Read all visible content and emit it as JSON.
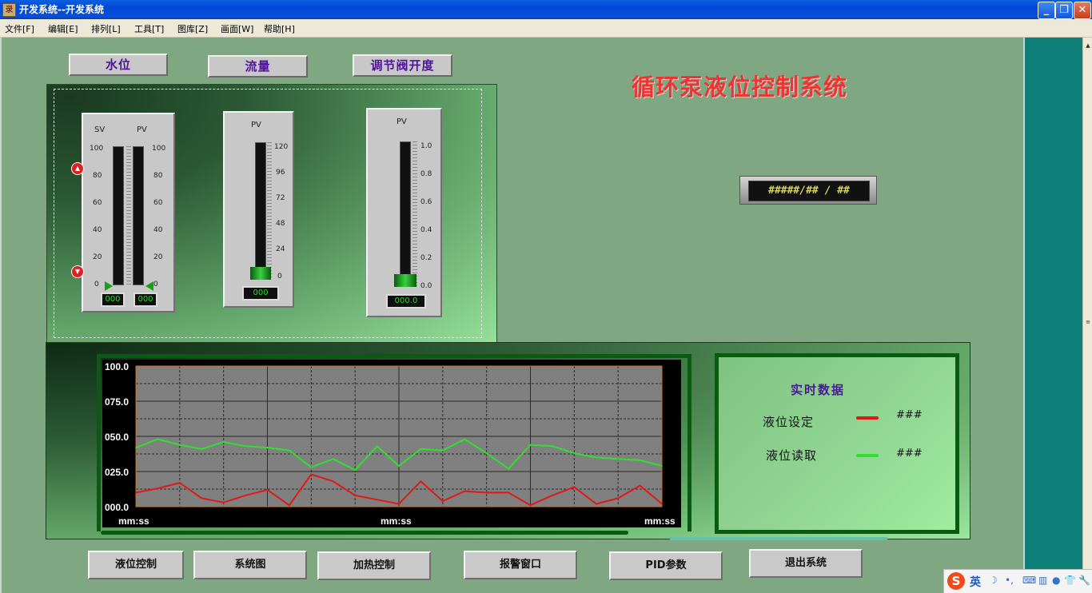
{
  "window": {
    "title": "开发系统--开发系统",
    "icon_glyph": "录",
    "minimize_glyph": "_",
    "maximize_glyph": "❐",
    "close_glyph": "✕"
  },
  "menu": [
    "文件[F]",
    "编辑[E]",
    "排列[L]",
    "工具[T]",
    "图库[Z]",
    "画面[W]",
    "帮助[H]"
  ],
  "tabs": {
    "water_level": "水位",
    "flow": "流量",
    "valve_opening": "调节阀开度"
  },
  "system_title": "循环泵液位控制系统",
  "lcd_display": "#####/## / ##",
  "gauges": {
    "level": {
      "sv_label": "SV",
      "pv_label": "PV",
      "ticks": [
        "100",
        "80",
        "60",
        "40",
        "20",
        "0"
      ],
      "sv_readout": "000",
      "pv_readout": "000",
      "sv_fill_fraction": 0,
      "pv_fill_fraction": 0
    },
    "flow": {
      "label": "PV",
      "ticks": [
        "120",
        "96",
        "72",
        "48",
        "24",
        "0"
      ],
      "readout": "000",
      "fill_fraction": 0.08
    },
    "valve": {
      "label": "PV",
      "ticks": [
        "1.0",
        "0.8",
        "0.6",
        "0.4",
        "0.2",
        "0.0"
      ],
      "readout": "000.0",
      "fill_fraction": 0.08
    }
  },
  "chart_data": {
    "type": "line",
    "ylim": [
      0,
      100
    ],
    "y_ticks": [
      "100.0",
      "075.0",
      "050.0",
      "025.0",
      "000.0"
    ],
    "x_labels": [
      "mm:ss",
      "mm:ss",
      "mm:ss"
    ],
    "x": [
      0,
      1,
      2,
      3,
      4,
      5,
      6,
      7,
      8,
      9,
      10,
      11,
      12,
      13,
      14,
      15,
      16,
      17,
      18,
      19,
      20,
      21,
      22,
      23,
      24
    ],
    "series": [
      {
        "color": "#30e030",
        "values": [
          42,
          48,
          44,
          41,
          46,
          43,
          42,
          40,
          28,
          34,
          26,
          43,
          29,
          41,
          40,
          48,
          38,
          27,
          44,
          43,
          38,
          35,
          34,
          33,
          29
        ]
      },
      {
        "color": "#e01818",
        "values": [
          10,
          13,
          17,
          6,
          3,
          8,
          12,
          1,
          23,
          18,
          8,
          5,
          2,
          18,
          4,
          11,
          10,
          10,
          1,
          8,
          14,
          2,
          6,
          15,
          2
        ]
      }
    ]
  },
  "realtime": {
    "title": "实时数据",
    "rows": [
      {
        "label": "液位设定",
        "color": "#e01818",
        "value": "###"
      },
      {
        "label": "液位读取",
        "color": "#30e030",
        "value": "###"
      }
    ]
  },
  "bottom_buttons": {
    "level_control": "液位控制",
    "system_diagram": "系统图",
    "heating_control": "加热控制",
    "alarm_window": "报警窗口",
    "pid_params": "PID参数",
    "exit_system": "退出系统"
  },
  "ime": {
    "logo": "S",
    "lang": "英",
    "icons": [
      "☽",
      "•,",
      "⌨",
      "▥",
      "●",
      "👕",
      "🔧"
    ]
  }
}
